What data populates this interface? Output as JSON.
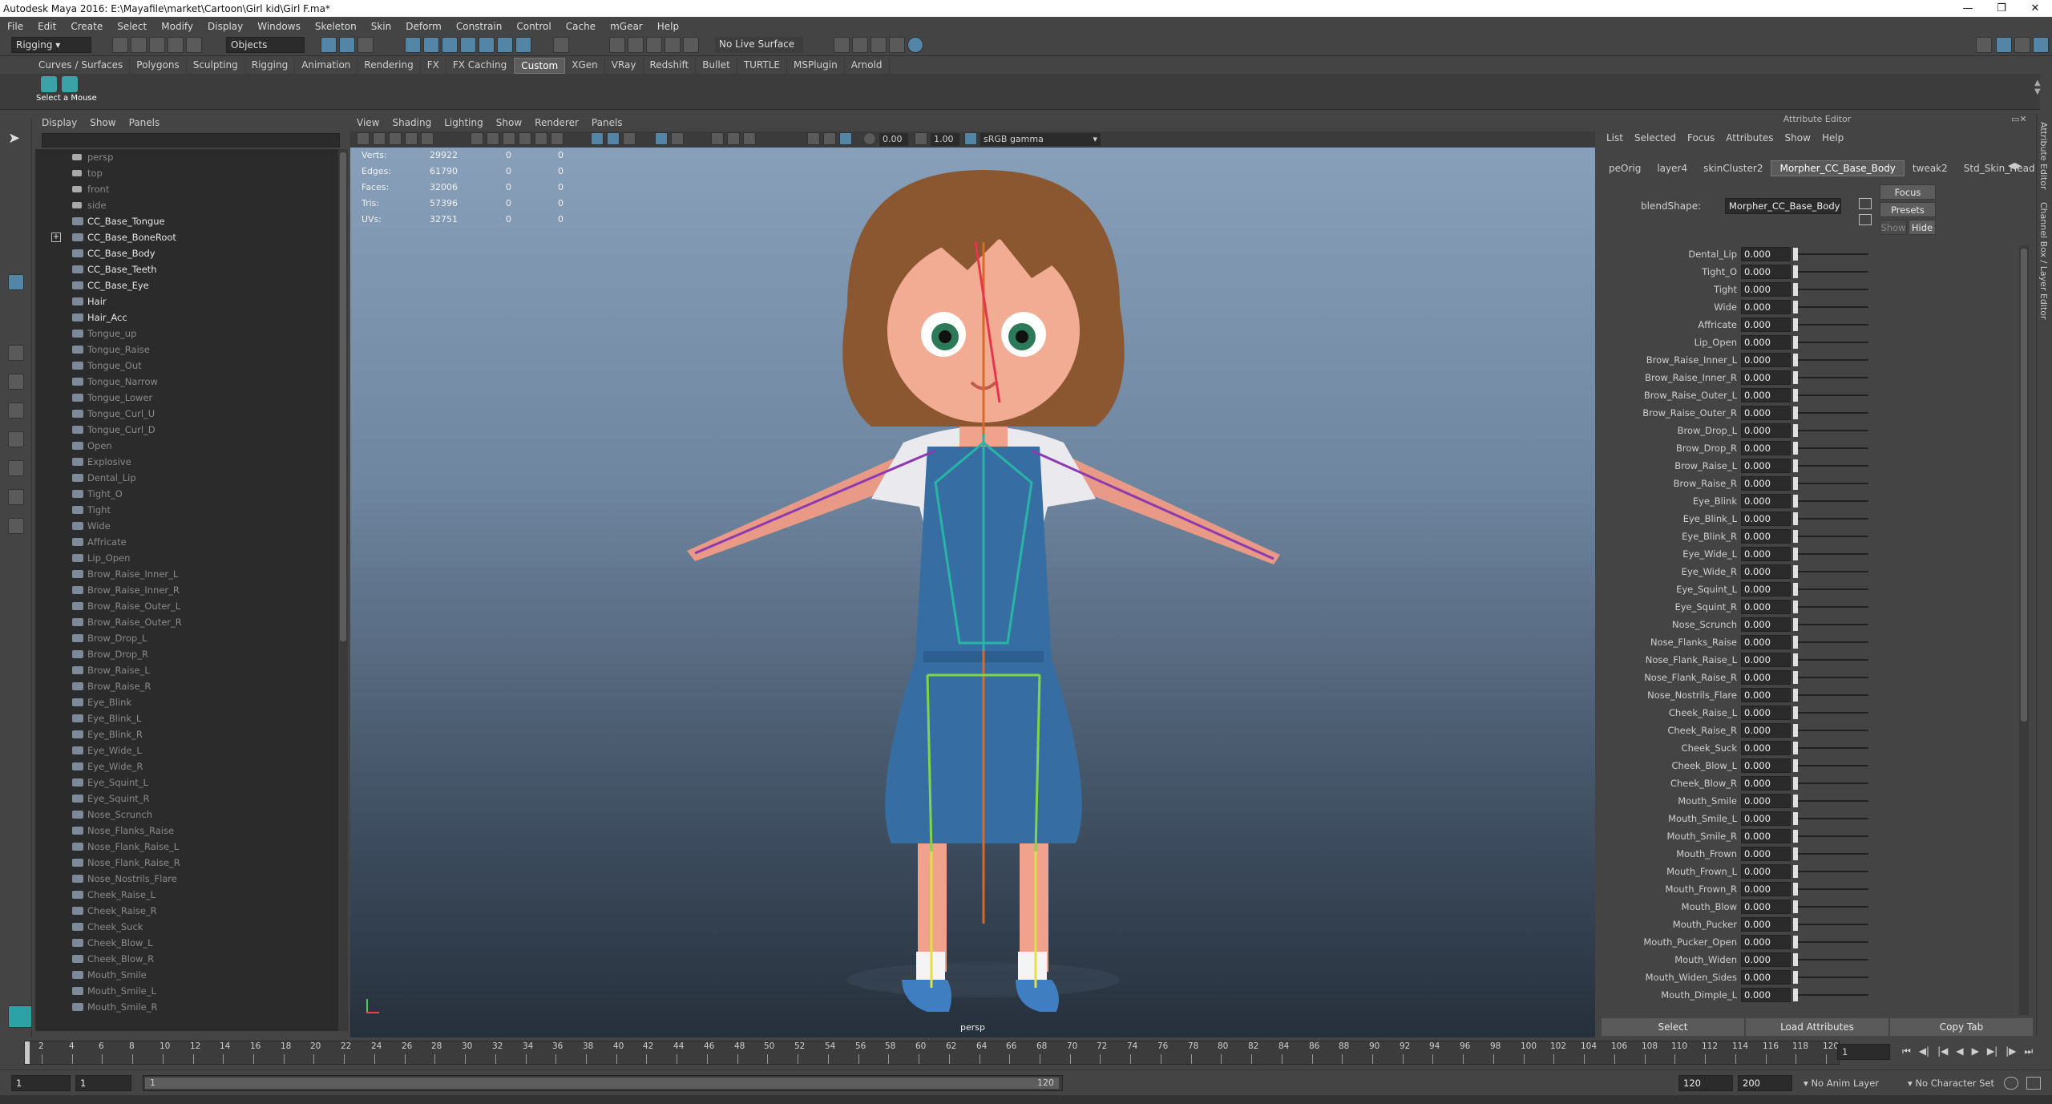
{
  "window": {
    "title": "Autodesk Maya 2016: E:\\Mayafile\\market\\Cartoon\\Girl kid\\Girl F.ma*"
  },
  "menubar": [
    "File",
    "Edit",
    "Create",
    "Select",
    "Modify",
    "Display",
    "Windows",
    "Skeleton",
    "Skin",
    "Deform",
    "Constrain",
    "Control",
    "Cache",
    "mGear",
    "Help"
  ],
  "status": {
    "menuset": "Rigging",
    "select_mode": "Objects",
    "live_surface": "No Live Surface"
  },
  "shelf": {
    "tabs": [
      "Curves / Surfaces",
      "Polygons",
      "Sculpting",
      "Rigging",
      "Animation",
      "Rendering",
      "FX",
      "FX Caching",
      "Custom",
      "XGen",
      "VRay",
      "Redshift",
      "Bullet",
      "TURTLE",
      "MSPlugin",
      "Arnold"
    ],
    "active": "Custom",
    "button_label": "Select a Mouse"
  },
  "outliner": {
    "menu": [
      "Display",
      "Show",
      "Panels"
    ],
    "items": [
      {
        "label": "persp",
        "kind": "cam",
        "style": "dim"
      },
      {
        "label": "top",
        "kind": "cam",
        "style": "dim"
      },
      {
        "label": "front",
        "kind": "cam",
        "style": "dim"
      },
      {
        "label": "side",
        "kind": "cam",
        "style": "dim"
      },
      {
        "label": "CC_Base_Tongue",
        "kind": "mesh",
        "style": "brt"
      },
      {
        "label": "CC_Base_BoneRoot",
        "kind": "joint",
        "style": "brt",
        "expand": true
      },
      {
        "label": "CC_Base_Body",
        "kind": "mesh",
        "style": "brt"
      },
      {
        "label": "CC_Base_Teeth",
        "kind": "mesh",
        "style": "brt"
      },
      {
        "label": "CC_Base_Eye",
        "kind": "mesh",
        "style": "brt"
      },
      {
        "label": "Hair",
        "kind": "mesh",
        "style": "brt"
      },
      {
        "label": "Hair_Acc",
        "kind": "mesh",
        "style": "brt"
      },
      {
        "label": "Tongue_up",
        "kind": "mesh",
        "style": "dim"
      },
      {
        "label": "Tongue_Raise",
        "kind": "mesh",
        "style": "dim"
      },
      {
        "label": "Tongue_Out",
        "kind": "mesh",
        "style": "dim"
      },
      {
        "label": "Tongue_Narrow",
        "kind": "mesh",
        "style": "dim"
      },
      {
        "label": "Tongue_Lower",
        "kind": "mesh",
        "style": "dim"
      },
      {
        "label": "Tongue_Curl_U",
        "kind": "mesh",
        "style": "dim"
      },
      {
        "label": "Tongue_Curl_D",
        "kind": "mesh",
        "style": "dim"
      },
      {
        "label": "Open",
        "kind": "mesh",
        "style": "dim"
      },
      {
        "label": "Explosive",
        "kind": "mesh",
        "style": "dim"
      },
      {
        "label": "Dental_Lip",
        "kind": "mesh",
        "style": "dim"
      },
      {
        "label": "Tight_O",
        "kind": "mesh",
        "style": "dim"
      },
      {
        "label": "Tight",
        "kind": "mesh",
        "style": "dim"
      },
      {
        "label": "Wide",
        "kind": "mesh",
        "style": "dim"
      },
      {
        "label": "Affricate",
        "kind": "mesh",
        "style": "dim"
      },
      {
        "label": "Lip_Open",
        "kind": "mesh",
        "style": "dim"
      },
      {
        "label": "Brow_Raise_Inner_L",
        "kind": "mesh",
        "style": "dim"
      },
      {
        "label": "Brow_Raise_Inner_R",
        "kind": "mesh",
        "style": "dim"
      },
      {
        "label": "Brow_Raise_Outer_L",
        "kind": "mesh",
        "style": "dim"
      },
      {
        "label": "Brow_Raise_Outer_R",
        "kind": "mesh",
        "style": "dim"
      },
      {
        "label": "Brow_Drop_L",
        "kind": "mesh",
        "style": "dim"
      },
      {
        "label": "Brow_Drop_R",
        "kind": "mesh",
        "style": "dim"
      },
      {
        "label": "Brow_Raise_L",
        "kind": "mesh",
        "style": "dim"
      },
      {
        "label": "Brow_Raise_R",
        "kind": "mesh",
        "style": "dim"
      },
      {
        "label": "Eye_Blink",
        "kind": "mesh",
        "style": "dim"
      },
      {
        "label": "Eye_Blink_L",
        "kind": "mesh",
        "style": "dim"
      },
      {
        "label": "Eye_Blink_R",
        "kind": "mesh",
        "style": "dim"
      },
      {
        "label": "Eye_Wide_L",
        "kind": "mesh",
        "style": "dim"
      },
      {
        "label": "Eye_Wide_R",
        "kind": "mesh",
        "style": "dim"
      },
      {
        "label": "Eye_Squint_L",
        "kind": "mesh",
        "style": "dim"
      },
      {
        "label": "Eye_Squint_R",
        "kind": "mesh",
        "style": "dim"
      },
      {
        "label": "Nose_Scrunch",
        "kind": "mesh",
        "style": "dim"
      },
      {
        "label": "Nose_Flanks_Raise",
        "kind": "mesh",
        "style": "dim"
      },
      {
        "label": "Nose_Flank_Raise_L",
        "kind": "mesh",
        "style": "dim"
      },
      {
        "label": "Nose_Flank_Raise_R",
        "kind": "mesh",
        "style": "dim"
      },
      {
        "label": "Nose_Nostrils_Flare",
        "kind": "mesh",
        "style": "dim"
      },
      {
        "label": "Cheek_Raise_L",
        "kind": "mesh",
        "style": "dim"
      },
      {
        "label": "Cheek_Raise_R",
        "kind": "mesh",
        "style": "dim"
      },
      {
        "label": "Cheek_Suck",
        "kind": "mesh",
        "style": "dim"
      },
      {
        "label": "Cheek_Blow_L",
        "kind": "mesh",
        "style": "dim"
      },
      {
        "label": "Cheek_Blow_R",
        "kind": "mesh",
        "style": "dim"
      },
      {
        "label": "Mouth_Smile",
        "kind": "mesh",
        "style": "dim"
      },
      {
        "label": "Mouth_Smile_L",
        "kind": "mesh",
        "style": "dim"
      },
      {
        "label": "Mouth_Smile_R",
        "kind": "mesh",
        "style": "dim"
      }
    ]
  },
  "viewport": {
    "menu": [
      "View",
      "Shading",
      "Lighting",
      "Show",
      "Renderer",
      "Panels"
    ],
    "exposure": "0.00",
    "gamma": "1.00",
    "colorspace": "sRGB gamma",
    "camera_label": "persp",
    "hud": [
      {
        "label": "Verts:",
        "value": "29922",
        "sel": "0",
        "comp": "0"
      },
      {
        "label": "Edges:",
        "value": "61790",
        "sel": "0",
        "comp": "0"
      },
      {
        "label": "Faces:",
        "value": "32006",
        "sel": "0",
        "comp": "0"
      },
      {
        "label": "Tris:",
        "value": "57396",
        "sel": "0",
        "comp": "0"
      },
      {
        "label": "UVs:",
        "value": "32751",
        "sel": "0",
        "comp": "0"
      }
    ]
  },
  "attribute_editor": {
    "title": "Attribute Editor",
    "menu": [
      "List",
      "Selected",
      "Focus",
      "Attributes",
      "Show",
      "Help"
    ],
    "tabs": [
      "peOrig",
      "layer4",
      "skinCluster2",
      "Morpher_CC_Base_Body",
      "tweak2",
      "Std_Skin_Head"
    ],
    "active_tab": "Morpher_CC_Base_Body",
    "blendshape_label": "blendShape:",
    "blendshape_value": "Morpher_CC_Base_Body",
    "buttons": {
      "focus": "Focus",
      "presets": "Presets",
      "show": "Show",
      "hide": "Hide"
    },
    "attributes": [
      {
        "name": "Dental_Lip",
        "value": "0.000"
      },
      {
        "name": "Tight_O",
        "value": "0.000"
      },
      {
        "name": "Tight",
        "value": "0.000"
      },
      {
        "name": "Wide",
        "value": "0.000"
      },
      {
        "name": "Affricate",
        "value": "0.000"
      },
      {
        "name": "Lip_Open",
        "value": "0.000"
      },
      {
        "name": "Brow_Raise_Inner_L",
        "value": "0.000"
      },
      {
        "name": "Brow_Raise_Inner_R",
        "value": "0.000"
      },
      {
        "name": "Brow_Raise_Outer_L",
        "value": "0.000"
      },
      {
        "name": "Brow_Raise_Outer_R",
        "value": "0.000"
      },
      {
        "name": "Brow_Drop_L",
        "value": "0.000"
      },
      {
        "name": "Brow_Drop_R",
        "value": "0.000"
      },
      {
        "name": "Brow_Raise_L",
        "value": "0.000"
      },
      {
        "name": "Brow_Raise_R",
        "value": "0.000"
      },
      {
        "name": "Eye_Blink",
        "value": "0.000"
      },
      {
        "name": "Eye_Blink_L",
        "value": "0.000"
      },
      {
        "name": "Eye_Blink_R",
        "value": "0.000"
      },
      {
        "name": "Eye_Wide_L",
        "value": "0.000"
      },
      {
        "name": "Eye_Wide_R",
        "value": "0.000"
      },
      {
        "name": "Eye_Squint_L",
        "value": "0.000"
      },
      {
        "name": "Eye_Squint_R",
        "value": "0.000"
      },
      {
        "name": "Nose_Scrunch",
        "value": "0.000"
      },
      {
        "name": "Nose_Flanks_Raise",
        "value": "0.000"
      },
      {
        "name": "Nose_Flank_Raise_L",
        "value": "0.000"
      },
      {
        "name": "Nose_Flank_Raise_R",
        "value": "0.000"
      },
      {
        "name": "Nose_Nostrils_Flare",
        "value": "0.000"
      },
      {
        "name": "Cheek_Raise_L",
        "value": "0.000"
      },
      {
        "name": "Cheek_Raise_R",
        "value": "0.000"
      },
      {
        "name": "Cheek_Suck",
        "value": "0.000"
      },
      {
        "name": "Cheek_Blow_L",
        "value": "0.000"
      },
      {
        "name": "Cheek_Blow_R",
        "value": "0.000"
      },
      {
        "name": "Mouth_Smile",
        "value": "0.000"
      },
      {
        "name": "Mouth_Smile_L",
        "value": "0.000"
      },
      {
        "name": "Mouth_Smile_R",
        "value": "0.000"
      },
      {
        "name": "Mouth_Frown",
        "value": "0.000"
      },
      {
        "name": "Mouth_Frown_L",
        "value": "0.000"
      },
      {
        "name": "Mouth_Frown_R",
        "value": "0.000"
      },
      {
        "name": "Mouth_Blow",
        "value": "0.000"
      },
      {
        "name": "Mouth_Pucker",
        "value": "0.000"
      },
      {
        "name": "Mouth_Pucker_Open",
        "value": "0.000"
      },
      {
        "name": "Mouth_Widen",
        "value": "0.000"
      },
      {
        "name": "Mouth_Widen_Sides",
        "value": "0.000"
      },
      {
        "name": "Mouth_Dimple_L",
        "value": "0.000"
      }
    ],
    "bottom_buttons": [
      "Select",
      "Load Attributes",
      "Copy Tab"
    ]
  },
  "right_strip": [
    "Attribute Editor",
    "Channel Box / Layer Editor"
  ],
  "timeslider": {
    "ticks": [
      "2",
      "4",
      "6",
      "8",
      "10",
      "12",
      "14",
      "16",
      "18",
      "20",
      "22",
      "24",
      "26",
      "28",
      "30",
      "32",
      "34",
      "36",
      "38",
      "40",
      "42",
      "44",
      "46",
      "48",
      "50",
      "52",
      "54",
      "56",
      "58",
      "60",
      "62",
      "64",
      "66",
      "68",
      "70",
      "72",
      "74",
      "76",
      "78",
      "80",
      "82",
      "84",
      "86",
      "88",
      "90",
      "92",
      "94",
      "96",
      "98",
      "100",
      "102",
      "104",
      "106",
      "108",
      "110",
      "112",
      "114",
      "116",
      "118",
      "120"
    ],
    "current_frame": "1"
  },
  "range": {
    "start": "1",
    "anim_start": "1",
    "slider_start": "1",
    "slider_end": "120",
    "anim_end": "120",
    "end": "200",
    "anim_layer": "No Anim Layer",
    "character_set": "No Character Set"
  }
}
